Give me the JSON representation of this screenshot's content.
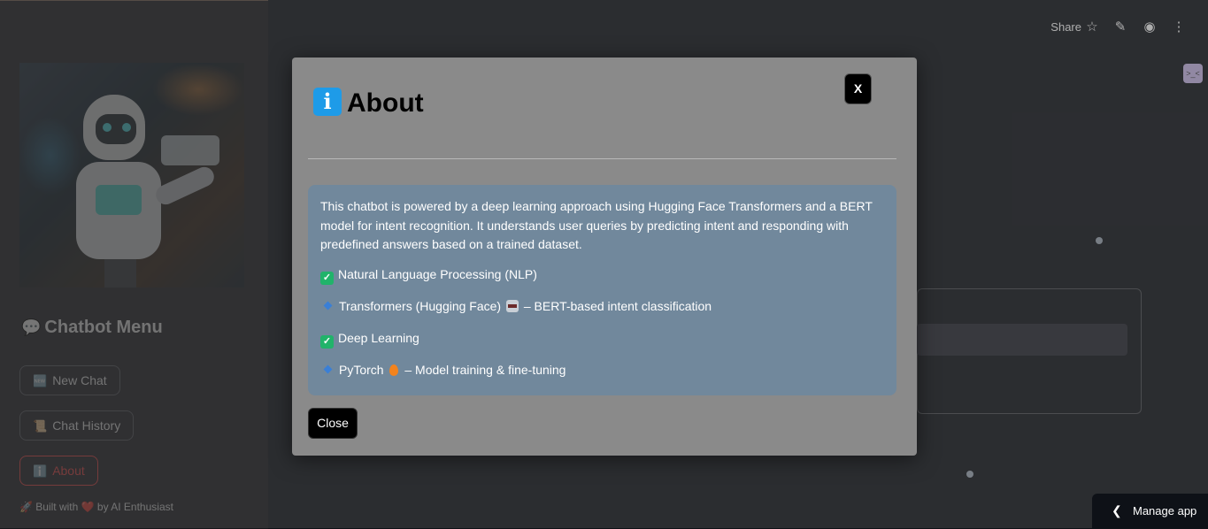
{
  "sidebar": {
    "title_icon": "speech-bubble-icon",
    "title": "Chatbot Menu",
    "buttons": [
      {
        "icon": "🆕",
        "label": "New Chat"
      },
      {
        "icon": "📜",
        "label": "Chat History"
      },
      {
        "icon": "ℹ️",
        "label": "About"
      }
    ],
    "footer": "🚀 Built with ❤️ by AI Enthusiast"
  },
  "topbar": {
    "share": "Share"
  },
  "modal": {
    "title": "About",
    "close_x": "X",
    "description": "This chatbot is powered by a deep learning approach using Hugging Face Transformers and a BERT model for intent recognition. It understands user queries by predicting intent and responding with predefined answers based on a trained dataset.",
    "features": [
      {
        "marker": "check",
        "text": "Natural Language Processing (NLP)"
      },
      {
        "marker": "diamond",
        "text_before": "Transformers (Hugging Face)",
        "text_after": "– BERT-based intent classification"
      },
      {
        "marker": "check",
        "text": "Deep Learning"
      },
      {
        "marker": "diamond",
        "text_before": "PyTorch",
        "text_after": "– Model training & fine-tuning"
      }
    ],
    "close_button": "Close"
  },
  "manage_app": "Manage app",
  "colors": {
    "accent": "#ff4b4b",
    "info_panel": "#71889c",
    "info_icon": "#1e9be8",
    "check": "#21b36a"
  }
}
